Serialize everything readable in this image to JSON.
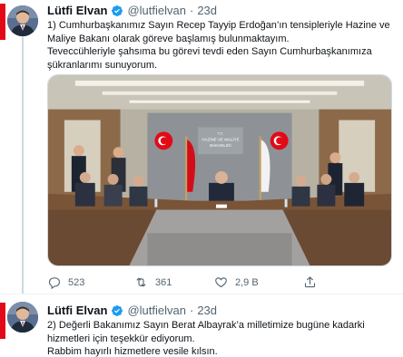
{
  "tweets": [
    {
      "author_name": "Lütfi Elvan",
      "handle": "@lutfielvan",
      "separator": "·",
      "time": "23d",
      "paragraphs": [
        "1) Cumhurbaşkanımız Sayın Recep Tayyip Erdoğan’ın tensipleriyle Hazine ve Maliye Bakanı olarak göreve başlamış bulunmaktayım.",
        "Teveccühleriyle şahsıma bu görevi tevdi eden Sayın Cumhurbaşkanımıza şükranlarımı sunuyorum."
      ],
      "photo": {
        "sign_line1": "T.C.",
        "sign_line2": "HAZİNE VE MALİYE",
        "sign_line3": "BAKANLIĞI"
      },
      "stats": {
        "replies": "523",
        "retweets": "361",
        "likes": "2,9 B"
      }
    },
    {
      "author_name": "Lütfi Elvan",
      "handle": "@lutfielvan",
      "separator": "·",
      "time": "23d",
      "paragraphs": [
        "2) Değerli Bakanımız Sayın Berat Albayrak’a milletimize bugüne kadarki hizmetleri için teşekkür ediyorum.",
        "Rabbim hayırlı hizmetlere vesile kılsın."
      ]
    }
  ],
  "icons": {
    "verified": "verified-badge-icon",
    "reply": "reply-icon",
    "retweet": "retweet-icon",
    "like": "like-icon",
    "share": "share-icon"
  },
  "colors": {
    "verified": "#1d9bf0",
    "muted": "#536471",
    "flag_red": "#e30a17"
  }
}
